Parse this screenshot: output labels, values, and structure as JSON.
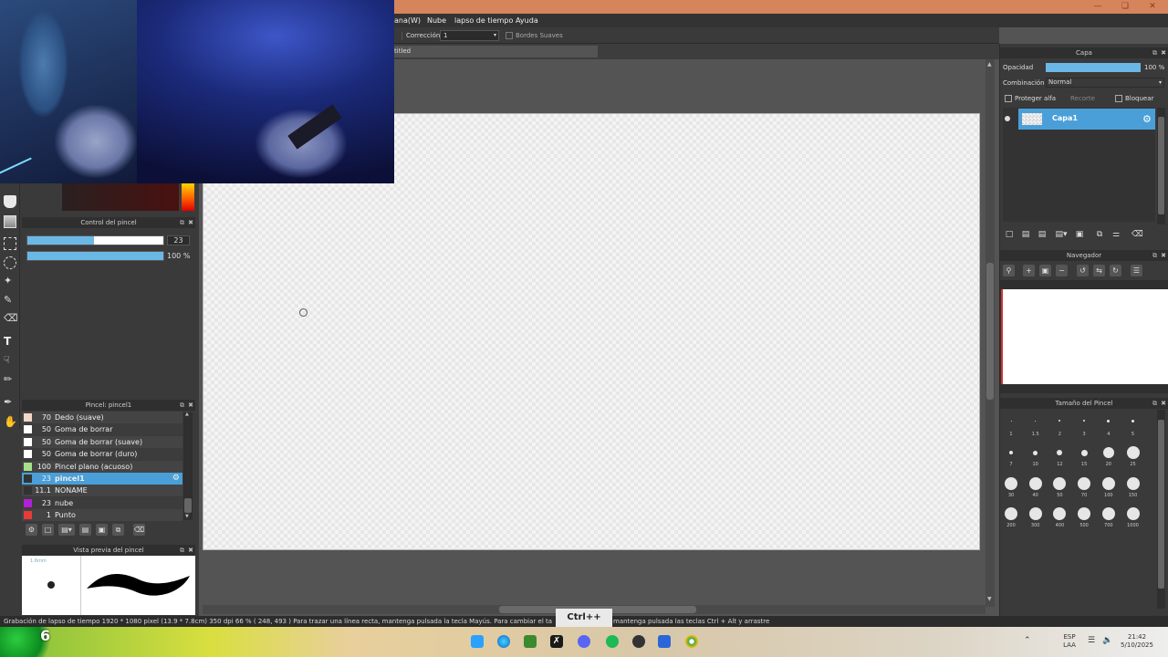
{
  "menu": {
    "items": [
      "ana(W)",
      "Nube",
      "lapso de tiempo",
      "Ayuda"
    ]
  },
  "toolbar": {
    "correction_label": "Corrección",
    "correction_value": "1",
    "soft_edges_label": "Bordes Suaves"
  },
  "document": {
    "tab_title": "titled"
  },
  "brush_control": {
    "title": "Control del pincel",
    "size_value": "23",
    "size_fraction": 0.49,
    "opacity_value": "100 %",
    "opacity_fraction": 1.0
  },
  "brush_list": {
    "title": "Pincel: pincel1",
    "items": [
      {
        "size": "70",
        "name": "Dedo (suave)",
        "color": "#f3d7c8",
        "selected": false
      },
      {
        "size": "50",
        "name": "Goma de borrar",
        "color": "#ffffff",
        "selected": false
      },
      {
        "size": "50",
        "name": "Goma de borrar (suave)",
        "color": "#ffffff",
        "selected": false
      },
      {
        "size": "50",
        "name": "Goma de borrar (duro)",
        "color": "#ffffff",
        "selected": false
      },
      {
        "size": "100",
        "name": "Pincel plano (acuoso)",
        "color": "#a6e08a",
        "selected": false
      },
      {
        "size": "23",
        "name": "pincel1",
        "color": "#333333",
        "selected": true
      },
      {
        "size": "11.1",
        "name": "NONAME",
        "color": "#333333",
        "selected": false
      },
      {
        "size": "23",
        "name": "nube",
        "color": "#b31fd6",
        "selected": false
      },
      {
        "size": "1",
        "name": "Punto",
        "color": "#e83a3a",
        "selected": false
      }
    ]
  },
  "brush_preview": {
    "title": "Vista previa del pincel",
    "size_text": "1.6mm"
  },
  "layer_panel": {
    "title": "Capa",
    "opacity_label": "Opacidad",
    "opacity_value": "100 %",
    "opacity_fraction": 1.0,
    "blend_label": "Combinación",
    "blend_value": "Normal",
    "protect_alpha_label": "Proteger alfa",
    "clipping_label": "Recorte",
    "lock_label": "Bloquear",
    "layers": [
      {
        "name": "Capa1",
        "selected": true
      }
    ]
  },
  "navigator": {
    "title": "Navegador"
  },
  "brush_size_panel": {
    "title": "Tamaño del Pincel",
    "sizes": [
      "1",
      "1.5",
      "2",
      "3",
      "4",
      "5",
      "7",
      "10",
      "12",
      "15",
      "20",
      "25",
      "30",
      "40",
      "50",
      "70",
      "100",
      "150",
      "200",
      "300",
      "400",
      "500",
      "700",
      "1000"
    ]
  },
  "status": {
    "text": "Grabación de lapso de tiempo   1920 * 1080 pixel   (13.9 * 7.8cm)   350 dpi   66 %   ( 248, 493 )   Para trazar una línea recta, mantenga pulsada la tecla Mayús. Para cambiar el ta",
    "text_tail": "mantenga pulsada las teclas Ctrl + Alt y arrastre"
  },
  "overlays": {
    "ctrl_hint": "Ctrl++",
    "counter": "6"
  },
  "taskbar": {
    "language_top": "ESP",
    "language_bottom": "LAA",
    "time": "21:42",
    "date": "5/10/2025"
  },
  "colors": {
    "accent": "#5ab0e2",
    "title_bar": "#d6845c",
    "selected_row": "#4a9fd8"
  }
}
